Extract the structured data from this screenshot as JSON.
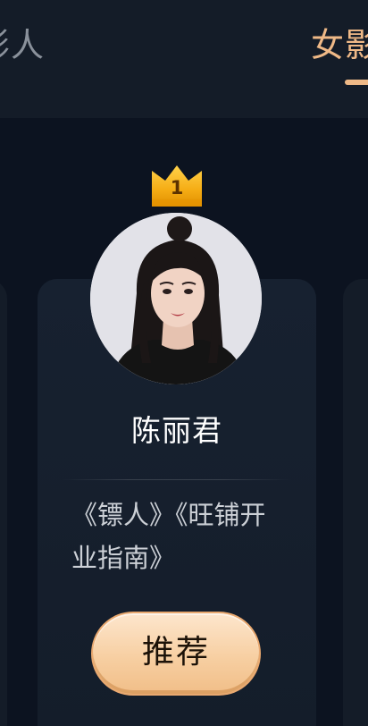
{
  "tabs": {
    "left_label": "影人",
    "active_label": "女影"
  },
  "card": {
    "rank": "1",
    "name": "陈丽君",
    "works": "《镖人》《旺铺开业指南》",
    "recommend_label": "推荐"
  },
  "colors": {
    "accent": "#efb987",
    "background": "#0c1320",
    "card": "#141c28",
    "crown": "#f5b21b"
  },
  "icons": {
    "crown": "crown-icon",
    "avatar": "avatar-photo"
  }
}
